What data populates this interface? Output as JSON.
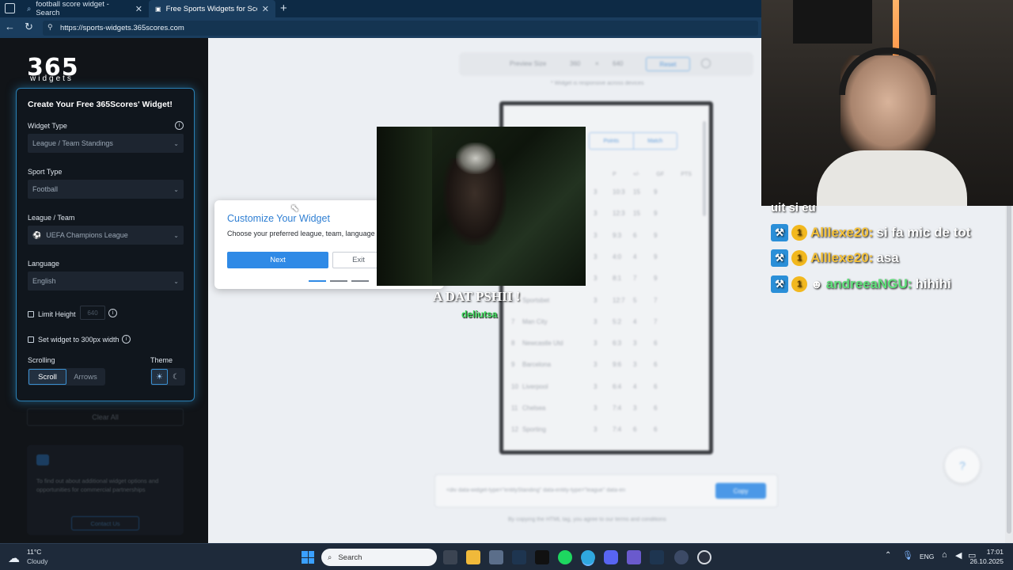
{
  "browser": {
    "tabs": [
      {
        "label": "football score widget - Search"
      },
      {
        "label": "Free Sports Widgets for Scores &"
      }
    ],
    "url": "https://sports-widgets.365scores.com"
  },
  "sidebar": {
    "logo": "365",
    "logo_sub": "widgets",
    "panel_title": "Create Your Free 365Scores' Widget!",
    "widget_type_label": "Widget Type",
    "widget_type_value": "League / Team Standings",
    "sport_type_label": "Sport Type",
    "sport_type_value": "Football",
    "league_label": "League / Team",
    "league_value": "UEFA Champions League",
    "language_label": "Language",
    "language_value": "English",
    "limit_height_label": "Limit Height",
    "limit_height_value": "640",
    "set_width_label": "Set widget to 300px width",
    "scrolling_label": "Scrolling",
    "scroll_option": "Scroll",
    "arrows_option": "Arrows",
    "theme_label": "Theme",
    "clear_all": "Clear All",
    "promo_text": "To find out about additional widget options and opportunities for commercial partnerships",
    "contact_button": "Contact Us"
  },
  "preview": {
    "size_label": "Preview Size",
    "width": "360",
    "height": "640",
    "reset": "Reset",
    "note": "* Widget is responsive across devices",
    "tabs": [
      "Points",
      "Match"
    ],
    "columns": [
      "P",
      "+/-",
      "GF",
      "PTS"
    ],
    "rows": [
      {
        "rank": "1",
        "team": "",
        "p": "3",
        "gd": "10:3",
        "gf": "15",
        "pts": "9"
      },
      {
        "rank": "2",
        "team": "",
        "p": "3",
        "gd": "12:3",
        "gf": "15",
        "pts": "9"
      },
      {
        "rank": "3",
        "team": "",
        "p": "3",
        "gd": "9:3",
        "gf": "6",
        "pts": "9"
      },
      {
        "rank": "4",
        "team": "",
        "p": "3",
        "gd": "4:0",
        "gf": "4",
        "pts": "9"
      },
      {
        "rank": "5",
        "team": "",
        "p": "3",
        "gd": "8:1",
        "gf": "7",
        "pts": "9"
      },
      {
        "rank": "6",
        "team": "Sportsbet",
        "p": "3",
        "gd": "12:7",
        "gf": "5",
        "pts": "7"
      },
      {
        "rank": "7",
        "team": "Man City",
        "p": "3",
        "gd": "5:2",
        "gf": "4",
        "pts": "7"
      },
      {
        "rank": "8",
        "team": "Newcastle Utd",
        "p": "3",
        "gd": "6:3",
        "gf": "3",
        "pts": "6"
      },
      {
        "rank": "9",
        "team": "Barcelona",
        "p": "3",
        "gd": "9:6",
        "gf": "3",
        "pts": "6"
      },
      {
        "rank": "10",
        "team": "Liverpool",
        "p": "3",
        "gd": "6:4",
        "gf": "4",
        "pts": "6"
      },
      {
        "rank": "11",
        "team": "Chelsea",
        "p": "3",
        "gd": "7:4",
        "gf": "3",
        "pts": "6"
      },
      {
        "rank": "12",
        "team": "Sporting",
        "p": "3",
        "gd": "7:4",
        "gf": "6",
        "pts": "6"
      }
    ],
    "code_text": "<div data-widget-type=\"entityStanding\" data-entity-type=\"league\" data-en",
    "copy_button": "Copy",
    "terms": "By copying the HTML tag, you agree to our terms and conditions"
  },
  "modal": {
    "title": "Customize Your Widget",
    "body": "Choose your preferred league, team, language",
    "next": "Next",
    "exit": "Exit"
  },
  "overlay": {
    "caption": "A DAT PSHII !",
    "user": "deliutsa"
  },
  "chat": {
    "partial": "uit si eu",
    "messages": [
      {
        "user": "Alllexe20:",
        "text": "si fa mic de tot",
        "user_color": "#f5c23a"
      },
      {
        "user": "Alllexe20:",
        "text": "asa",
        "user_color": "#f5c23a"
      },
      {
        "user": "andreeaNGU:",
        "text": "hihihi",
        "user_color": "#5fe07a"
      }
    ]
  },
  "taskbar": {
    "weather_temp": "11°C",
    "weather_desc": "Cloudy",
    "search": "Search",
    "lang": "ENG",
    "time": "17:01",
    "date": "26.10.2025"
  }
}
